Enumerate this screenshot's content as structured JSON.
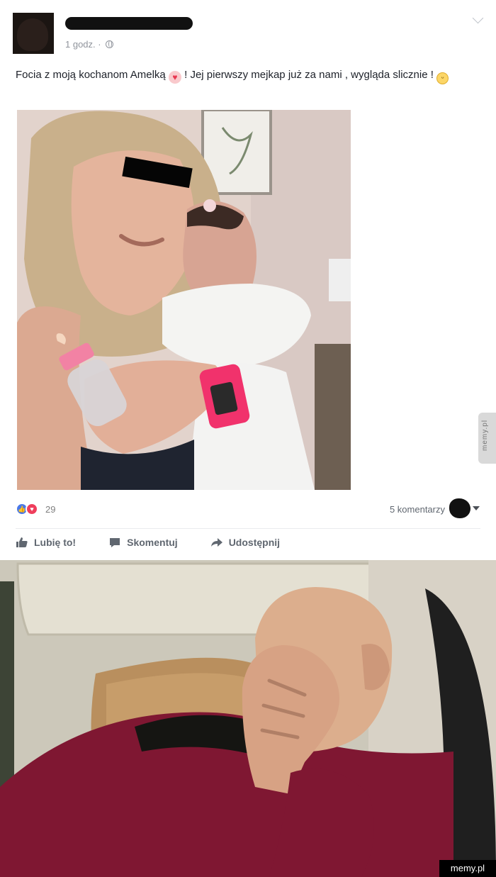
{
  "post": {
    "timestamp": "1 godz. ·",
    "text_before_heart": "Focia z moją kochanom Amelką ",
    "heart_icon": "heart-emoji-icon",
    "text_after_heart": " ! Jej pierwszy mejkap już za nami , wygląda slicznie ! ",
    "smile_icon": "smile-emoji-icon"
  },
  "reactions": {
    "count": "29",
    "icons": [
      "like-reaction-icon",
      "love-reaction-icon"
    ],
    "comments_label": "5 komentarzy"
  },
  "actions": {
    "like": "Lubię to!",
    "comment": "Skomentuj",
    "share": "Udostępnij"
  },
  "watermark": {
    "side": "memy.pl",
    "bottom": "memy.pl"
  },
  "colors": {
    "like_blue": "#4a78e8",
    "love_red": "#ef3e5c",
    "muted_text": "#90949c"
  }
}
